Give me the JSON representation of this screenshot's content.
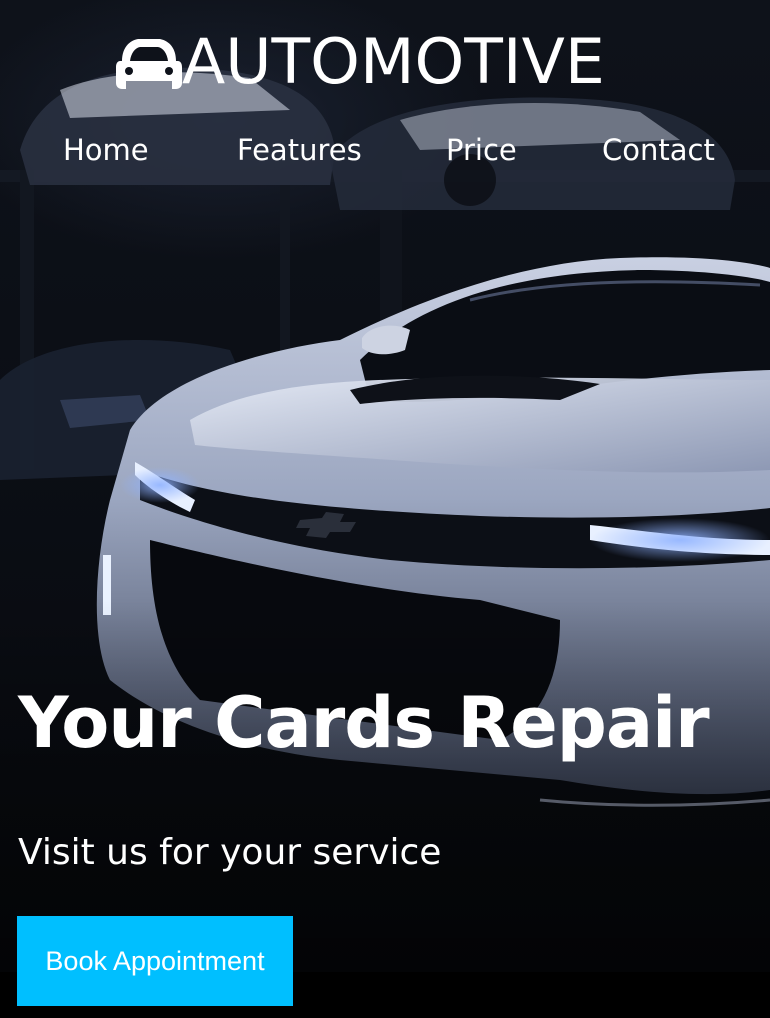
{
  "brand": {
    "name": "AUTOMOTIVE",
    "icon": "car-icon"
  },
  "nav": {
    "items": [
      {
        "label": "Home"
      },
      {
        "label": "Features"
      },
      {
        "label": "Price"
      },
      {
        "label": "Contact"
      }
    ]
  },
  "hero": {
    "title": "Your Cards Repair",
    "subtitle": "Visit us for your service",
    "cta_label": "Book Appointment",
    "background": "car-photo"
  },
  "colors": {
    "accent": "#00bfff",
    "text": "#ffffff",
    "background": "#0b0e15"
  }
}
